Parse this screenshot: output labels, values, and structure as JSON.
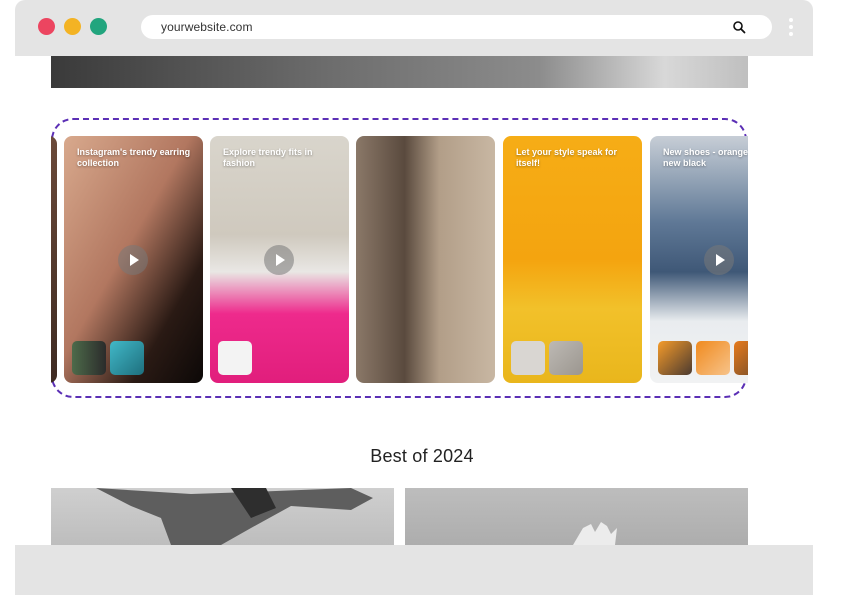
{
  "browser": {
    "url": "yourwebsite.com",
    "controls": [
      "close-dot",
      "minimize-dot",
      "maximize-dot"
    ]
  },
  "gallery": {
    "cards": [
      {
        "title": "",
        "has_play": false
      },
      {
        "title": "Instagram's trendy earring collection",
        "has_play": true
      },
      {
        "title": "Explore trendy fits in fashion",
        "has_play": true
      },
      {
        "title": "",
        "has_play": false
      },
      {
        "title": "Let your style speak for itself!",
        "has_play": false
      },
      {
        "title": "New shoes - orange is the new black",
        "has_play": true
      }
    ]
  },
  "section": {
    "title": "Best of 2024"
  },
  "colors": {
    "accent_dashed_border": "#5b2fb5",
    "dot_red": "#ec4560",
    "dot_yellow": "#f3b324",
    "dot_green": "#22a57e",
    "chrome": "#e4e4e4"
  },
  "icons": {
    "search": "search-icon",
    "menu": "kebab-menu-icon",
    "play": "play-icon"
  }
}
